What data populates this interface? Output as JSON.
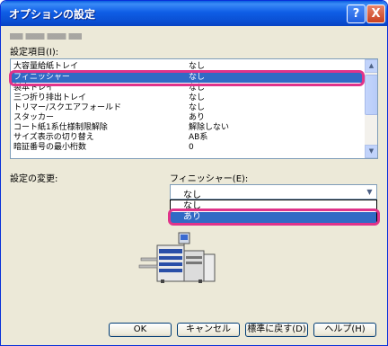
{
  "window": {
    "title": "オプションの設定",
    "help_button": "?",
    "close_button": "X"
  },
  "settings_items": {
    "label": "設定項目(I):",
    "rows": [
      {
        "name": "大容量給紙トレイ",
        "value": "なし"
      },
      {
        "name": "フィニッシャー",
        "value": "なし"
      },
      {
        "name": "製本トレイ",
        "value": "なし"
      },
      {
        "name": "三つ折り排出トレイ",
        "value": "なし"
      },
      {
        "name": "トリマー/スクエアフォールド",
        "value": "なし"
      },
      {
        "name": "スタッカー",
        "value": "あり"
      },
      {
        "name": "コート紙1系仕様制限解除",
        "value": "解除しない"
      },
      {
        "name": "サイズ表示の切り替え",
        "value": "AB系"
      },
      {
        "name": "暗証番号の最小桁数",
        "value": "0"
      }
    ],
    "selected_index": 1
  },
  "change_setting": {
    "label": "設定の変更:",
    "field_label": "フィニッシャー(E):",
    "current_value": "なし",
    "options": [
      "なし",
      "あり"
    ],
    "highlighted_option": "あり"
  },
  "buttons": {
    "ok": "OK",
    "cancel": "キャンセル",
    "restore_default": "標準に戻す(D)",
    "help": "ヘルプ(H)"
  },
  "colors": {
    "selection": "#316ac5",
    "highlight_annotation": "#e0338a",
    "titlebar": "#0a4fd3"
  }
}
